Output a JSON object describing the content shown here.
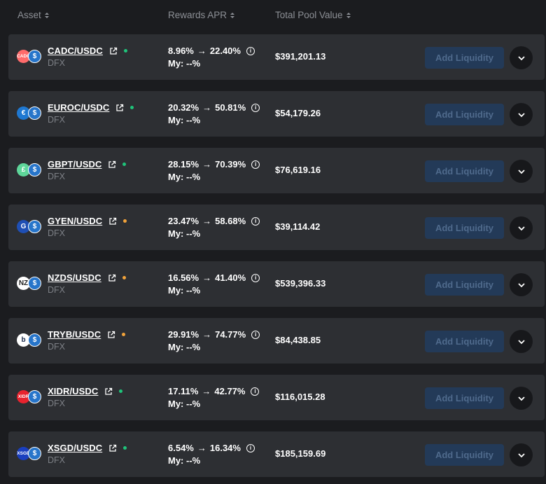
{
  "headers": {
    "asset": "Asset",
    "apr": "Rewards APR",
    "tvl": "Total Pool Value"
  },
  "add_liquidity_label": "Add Liquidity",
  "colors": {
    "green": "#1fc47a",
    "orange": "#f2a33a",
    "usdc": "#2775ca"
  },
  "pools": [
    {
      "pair": "CADC/USDC",
      "protocol": "DFX",
      "apr_base": "8.96%",
      "apr_boost": "22.40%",
      "my": "My: --%",
      "tvl": "$391,201.13",
      "status": "green",
      "icon": "cadc-icon",
      "glyph": "CADC",
      "bg": "#ff6b6b",
      "fg": "#fff"
    },
    {
      "pair": "EUROC/USDC",
      "protocol": "DFX",
      "apr_base": "20.32%",
      "apr_boost": "50.81%",
      "my": "My: --%",
      "tvl": "$54,179.26",
      "status": "green",
      "icon": "euroc-icon",
      "glyph": "€",
      "bg": "#1f78d1",
      "fg": "#fff"
    },
    {
      "pair": "GBPT/USDC",
      "protocol": "DFX",
      "apr_base": "28.15%",
      "apr_boost": "70.39%",
      "my": "My: --%",
      "tvl": "$76,619.16",
      "status": "green",
      "icon": "gbpt-icon",
      "glyph": "£",
      "bg": "#5ed69a",
      "fg": "#fff"
    },
    {
      "pair": "GYEN/USDC",
      "protocol": "DFX",
      "apr_base": "23.47%",
      "apr_boost": "58.68%",
      "my": "My: --%",
      "tvl": "$39,114.42",
      "status": "orange",
      "icon": "gyen-icon",
      "glyph": "G",
      "bg": "#1f4fb4",
      "fg": "#fff"
    },
    {
      "pair": "NZDS/USDC",
      "protocol": "DFX",
      "apr_base": "16.56%",
      "apr_boost": "41.40%",
      "my": "My: --%",
      "tvl": "$539,396.33",
      "status": "orange",
      "icon": "nzds-icon",
      "glyph": "NZ",
      "bg": "#ffffff",
      "fg": "#222"
    },
    {
      "pair": "TRYB/USDC",
      "protocol": "DFX",
      "apr_base": "29.91%",
      "apr_boost": "74.77%",
      "my": "My: --%",
      "tvl": "$84,438.85",
      "status": "orange",
      "icon": "tryb-icon",
      "glyph": "b",
      "bg": "#ffffff",
      "fg": "#1a2a4a"
    },
    {
      "pair": "XIDR/USDC",
      "protocol": "DFX",
      "apr_base": "17.11%",
      "apr_boost": "42.77%",
      "my": "My: --%",
      "tvl": "$116,015.28",
      "status": "green",
      "icon": "xidr-icon",
      "glyph": "XIDR",
      "bg": "#e8232e",
      "fg": "#fff"
    },
    {
      "pair": "XSGD/USDC",
      "protocol": "DFX",
      "apr_base": "6.54%",
      "apr_boost": "16.34%",
      "my": "My: --%",
      "tvl": "$185,159.69",
      "status": "green",
      "icon": "xsgd-icon",
      "glyph": "XSGD",
      "bg": "#1a3fbf",
      "fg": "#fff"
    }
  ]
}
